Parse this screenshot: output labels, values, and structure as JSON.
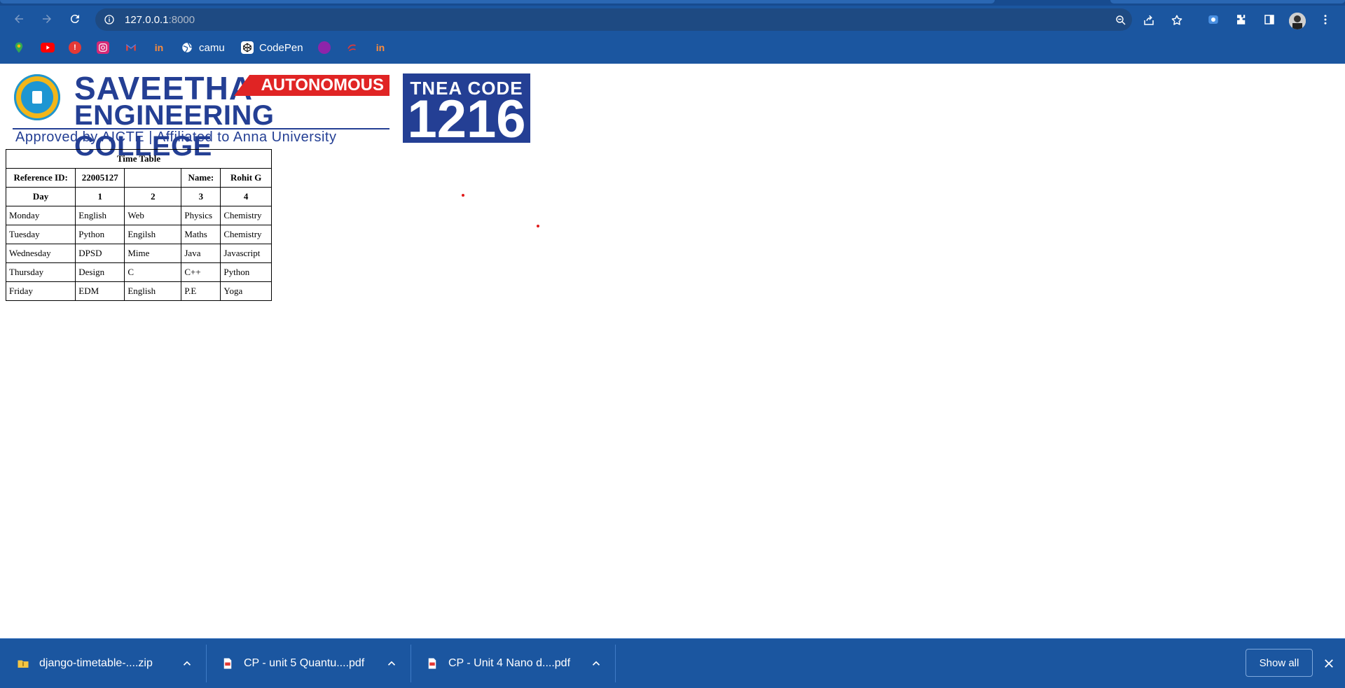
{
  "browser": {
    "url_host": "127.0.0.1",
    "url_port": ":8000"
  },
  "bookmarks": {
    "items": [
      {
        "label": "",
        "icon": "maps-icon"
      },
      {
        "label": "",
        "icon": "youtube-icon"
      },
      {
        "label": "",
        "icon": "alert-icon"
      },
      {
        "label": "",
        "icon": "instagram-icon"
      },
      {
        "label": "",
        "icon": "gmail-icon"
      },
      {
        "label": "",
        "icon": "invision-icon"
      },
      {
        "label": "camu",
        "icon": "globe-icon"
      },
      {
        "label": "CodePen",
        "icon": "codepen-icon"
      },
      {
        "label": "",
        "icon": "circle-icon"
      },
      {
        "label": "",
        "icon": "swirl-icon"
      },
      {
        "label": "",
        "icon": "invision-icon"
      }
    ]
  },
  "logo": {
    "college_line1": "SAVEETHA",
    "badge": "AUTONOMOUS",
    "college_line2": "ENGINEERING COLLEGE",
    "tagline": "Approved by AICTE  |  Affiliated to Anna University",
    "tnea_label": "TNEA CODE",
    "tnea_code": "1216"
  },
  "timetable": {
    "title": "Time Table",
    "ref_label": "Reference ID:",
    "ref_value": "22005127",
    "name_label": "Name:",
    "name_value": "Rohit G",
    "headers": [
      "Day",
      "1",
      "2",
      "3",
      "4"
    ],
    "rows": [
      [
        "Monday",
        "English",
        "Web",
        "Physics",
        "Chemistry"
      ],
      [
        "Tuesday",
        "Python",
        "Engilsh",
        "Maths",
        "Chemistry"
      ],
      [
        "Wednesday",
        "DPSD",
        "Mime",
        "Java",
        "Javascript"
      ],
      [
        "Thursday",
        "Design",
        "C",
        "C++",
        "Python"
      ],
      [
        "Friday",
        "EDM",
        "English",
        "P.E",
        "Yoga"
      ]
    ]
  },
  "downloads": {
    "items": [
      {
        "name": "django-timetable-....zip",
        "type": "zip"
      },
      {
        "name": "CP - unit 5 Quantu....pdf",
        "type": "pdf"
      },
      {
        "name": "CP - Unit 4 Nano d....pdf",
        "type": "pdf"
      }
    ],
    "show_all": "Show all"
  },
  "colors": {
    "chrome": "#1b56a0",
    "brand_blue": "#243f94",
    "badge_red": "#e02424"
  }
}
